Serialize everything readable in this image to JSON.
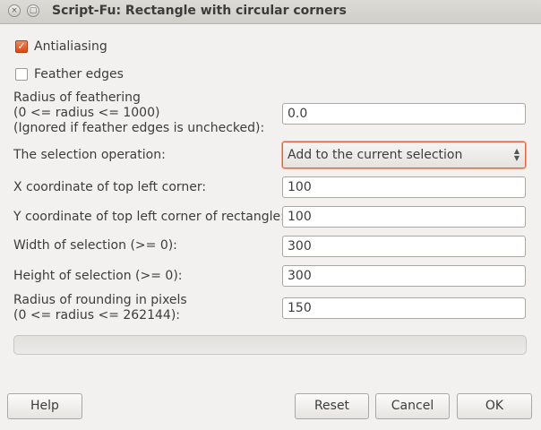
{
  "window": {
    "title": "Script-Fu: Rectangle with circular corners",
    "close_glyph": "×",
    "minimize_glyph": "▢"
  },
  "options": {
    "antialiasing": {
      "label": "Antialiasing",
      "checked": true
    },
    "feather_edges": {
      "label": "Feather edges",
      "checked": false
    }
  },
  "fields": {
    "feather_radius": {
      "label_lines": [
        "Radius of feathering",
        "(0 <= radius <= 1000)",
        "(Ignored if feather edges is unchecked):"
      ],
      "value": "0.0"
    },
    "selection_operation": {
      "label": "The selection operation:",
      "selected": "Add to the current selection"
    },
    "x_coord": {
      "label": "X coordinate of top left corner:",
      "value": "100"
    },
    "y_coord": {
      "label": "Y coordinate of top left corner of rectangle:",
      "value": "100"
    },
    "width": {
      "label": "Width of selection (>= 0):",
      "value": "300"
    },
    "height": {
      "label": "Height of selection (>= 0):",
      "value": "300"
    },
    "rounding_radius": {
      "label_lines": [
        "Radius of rounding in pixels",
        "(0 <= radius <= 262144):"
      ],
      "value": "150"
    }
  },
  "buttons": {
    "help": "Help",
    "reset": "Reset",
    "cancel": "Cancel",
    "ok": "OK"
  },
  "colors": {
    "accent": "#dd4814",
    "window_bg": "#f2f1f0"
  }
}
